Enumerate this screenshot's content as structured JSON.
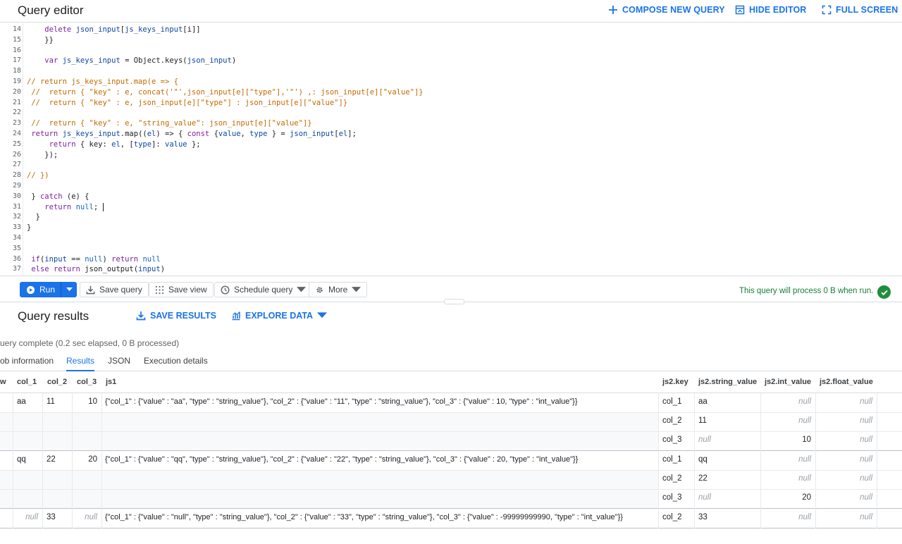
{
  "header": {
    "title": "Query editor",
    "compose": "COMPOSE NEW QUERY",
    "hide": "HIDE EDITOR",
    "fullscreen": "FULL SCREEN"
  },
  "editor": {
    "line_numbers": [
      "14",
      "15",
      "16",
      "17",
      "18",
      "19",
      "20",
      "21",
      "22",
      "23",
      "24",
      "25",
      "26",
      "27",
      "28",
      "29",
      "30",
      "31",
      "32",
      "33",
      "34",
      "35",
      "36",
      "37"
    ],
    "lines": [
      "    delete json_input[js_keys_input[i]]",
      "    }}",
      "",
      "    var js_keys_input = Object.keys(json_input)",
      "",
      "// return js_keys_input.map(e => {",
      " //  return { \"key\" : e, concat('\"',json_input[e][\"type\"],'\"') ,: json_input[e][\"value\"]}",
      " //  return { \"key\" : e, json_input[e][\"type\"] : json_input[e][\"value\"]}",
      "",
      " //  return { \"key\" : e, \"string_value\": json_input[e][\"value\"]}",
      " return js_keys_input.map((el) => { const {value, type } = json_input[el];",
      "     return { key: el, [type]: value };",
      "    });",
      "",
      "// })",
      "",
      " } catch (e) {",
      "    return null; ",
      "  }",
      "}",
      "",
      "",
      " if(input == null) return null",
      " else return json_output(input)"
    ]
  },
  "toolbar": {
    "run": "Run",
    "save_query": "Save query",
    "save_view": "Save view",
    "schedule": "Schedule query",
    "more": "More",
    "status": "This query will process 0 B when run."
  },
  "results": {
    "title": "Query results",
    "save": "SAVE RESULTS",
    "explore": "EXPLORE DATA",
    "complete": "uery complete (0.2 sec elapsed, 0 B processed)",
    "tabs": [
      "ob information",
      "Results",
      "JSON",
      "Execution details"
    ]
  },
  "table": {
    "headers": [
      "w",
      "col_1",
      "col_2",
      "col_3",
      "js1",
      "js2.key",
      "js2.string_value",
      "js2.int_value",
      "js2.float_value"
    ],
    "null_label": "null",
    "rows": [
      {
        "col_1": "aa",
        "col_2": "11",
        "col_3": "10",
        "js1": "{\"col_1\" : {\"value\" :  \"aa\", \"type\" : \"string_value\"}, \"col_2\" : {\"value\" :  \"11\", \"type\" : \"string_value\"}, \"col_3\" : {\"value\" :  10, \"type\" : \"int_value\"}}",
        "js2": [
          {
            "key": "col_1",
            "string_value": "aa",
            "int_value": "null",
            "float_value": "null"
          },
          {
            "key": "col_2",
            "string_value": "11",
            "int_value": "null",
            "float_value": "null"
          },
          {
            "key": "col_3",
            "string_value": "null",
            "int_value": "10",
            "float_value": "null"
          }
        ]
      },
      {
        "col_1": "qq",
        "col_2": "22",
        "col_3": "20",
        "js1": "{\"col_1\" : {\"value\" :  \"qq\", \"type\" : \"string_value\"}, \"col_2\" : {\"value\" :  \"22\", \"type\" : \"string_value\"}, \"col_3\" : {\"value\" :  20, \"type\" : \"int_value\"}}",
        "js2": [
          {
            "key": "col_1",
            "string_value": "qq",
            "int_value": "null",
            "float_value": "null"
          },
          {
            "key": "col_2",
            "string_value": "22",
            "int_value": "null",
            "float_value": "null"
          },
          {
            "key": "col_3",
            "string_value": "null",
            "int_value": "20",
            "float_value": "null"
          }
        ]
      },
      {
        "col_1": "null",
        "col_2": "33",
        "col_3": "null",
        "js1": "{\"col_1\" : {\"value\" :  \"null\", \"type\" : \"string_value\"}, \"col_2\" : {\"value\" :  \"33\", \"type\" : \"string_value\"}, \"col_3\" : {\"value\" :  -99999999990, \"type\" : \"int_value\"}}",
        "js2": [
          {
            "key": "col_2",
            "string_value": "33",
            "int_value": "null",
            "float_value": "null"
          }
        ]
      }
    ]
  }
}
